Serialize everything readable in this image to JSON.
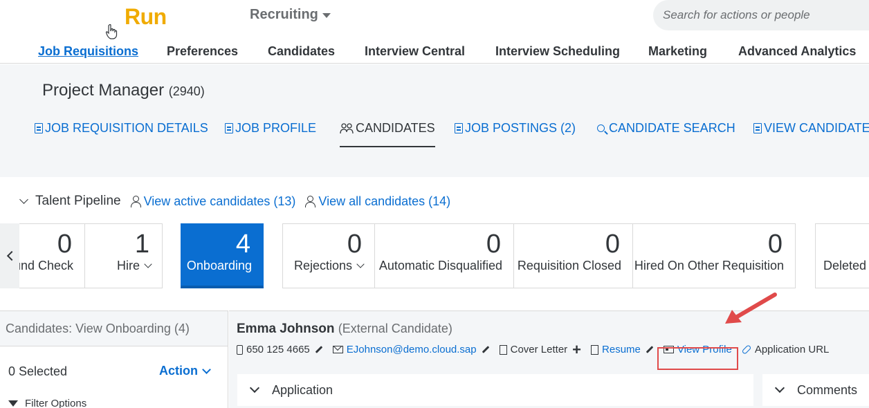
{
  "header": {
    "logo": "Run",
    "module": "Recruiting",
    "search_placeholder": "Search for actions or people"
  },
  "nav": [
    {
      "label": "Job Requisitions",
      "active": true
    },
    {
      "label": "Preferences"
    },
    {
      "label": "Candidates"
    },
    {
      "label": "Interview Central"
    },
    {
      "label": "Interview Scheduling"
    },
    {
      "label": "Marketing"
    },
    {
      "label": "Advanced Analytics"
    }
  ],
  "requisition": {
    "title": "Project Manager",
    "id": "(2940)"
  },
  "subnav": [
    {
      "label": "JOB REQUISITION DETAILS",
      "icon": "doc-icon"
    },
    {
      "label": "JOB PROFILE",
      "icon": "profile-doc-icon"
    },
    {
      "label": "CANDIDATES",
      "icon": "people-icon",
      "current": true
    },
    {
      "label": "JOB POSTINGS (2)",
      "icon": "doc-icon"
    },
    {
      "label": "CANDIDATE SEARCH",
      "icon": "search-icon"
    },
    {
      "label": "VIEW CANDIDATE F",
      "icon": "clipboard-icon"
    }
  ],
  "pipeline": {
    "label": "Talent Pipeline",
    "active_link": "View active candidates (13)",
    "all_link": "View all candidates (14)",
    "tiles": [
      {
        "count": "0",
        "label": "und Check"
      },
      {
        "count": "1",
        "label": "Hire",
        "dropdown": true
      },
      {
        "count": "4",
        "label": "Onboarding",
        "selected": true
      },
      {
        "count": "0",
        "label": "Rejections",
        "dropdown": true
      },
      {
        "count": "0",
        "label": "Automatic Disqualified"
      },
      {
        "count": "0",
        "label": "Requisition Closed"
      },
      {
        "count": "0",
        "label": "Hired On Other Requisition"
      },
      {
        "count": "",
        "label": "Deleted"
      }
    ]
  },
  "list_panel": {
    "header": "Candidates: View Onboarding (4)",
    "selected": "0 Selected",
    "action": "Action",
    "filter": "Filter Options"
  },
  "candidate": {
    "name": "Emma Johnson",
    "type": "(External Candidate)",
    "phone": "650 125 4665",
    "email": "EJohnson@demo.cloud.sap",
    "cover_letter": "Cover Letter",
    "resume": "Resume",
    "view_profile": "View Profile",
    "application_url": "Application URL",
    "sections": [
      "Application",
      "Comments"
    ]
  },
  "colors": {
    "accent": "#0a6ed1",
    "logo": "#f0ab00",
    "annotation": "#e04a4a"
  }
}
